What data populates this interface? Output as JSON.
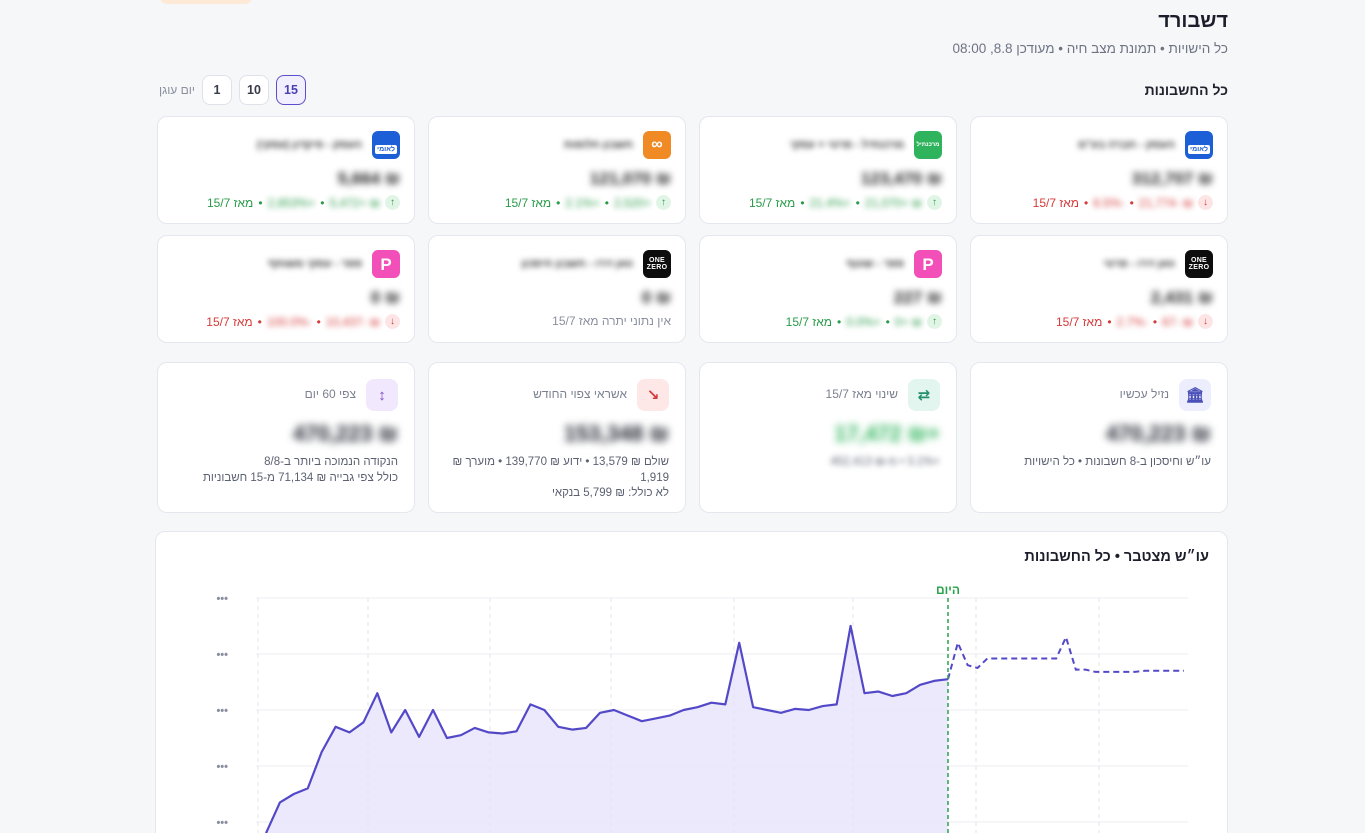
{
  "header": {
    "title": "דשבורד",
    "subtitle": "כל הישויות • תמונת מצב חיה • מעודכן 8.8, 08:00"
  },
  "accounts_section": {
    "title": "כל החשבונות",
    "window_label": "יום עוגן",
    "window_options": [
      "1",
      "10",
      "15"
    ],
    "active_window": "15"
  },
  "accounts": [
    {
      "logo": "leumi-logo",
      "logo_text": "לאומי",
      "name": "העסק - חברה בע\"מ",
      "balance": "₪ 312,707",
      "dir": "down",
      "amount": "₪ -21,774",
      "pct": "-6.5%",
      "since": "מאז 15/7"
    },
    {
      "logo": "green-bank-logo",
      "logo_text": "מרכנתיל",
      "name": "מרכנתיל - פרטי + עסקי",
      "balance": "₪ 123,470",
      "dir": "up",
      "amount": "₪ +21,070",
      "pct": "+21.4%",
      "since": "מאז 15/7"
    },
    {
      "logo": "orange-logo",
      "logo_text": "∞",
      "name": "חשבון חלופות",
      "balance": "₪ 121,070",
      "dir": "up",
      "amount": "+2,520",
      "pct": "+2.1%",
      "since": "מאז 15/7"
    },
    {
      "logo": "leumi-logo",
      "logo_text": "לאומי",
      "name": "העסק - פיקדון (עסקי)",
      "balance": "₪ 5,664",
      "dir": "up",
      "amount": "₪ +5,472",
      "pct": "+2,853%",
      "since": "מאז 15/7"
    },
    {
      "logo": "onezero-logo",
      "logo_text": "ONE ZERO",
      "name": "וואן זירו - פרטי",
      "balance": "₪ 2,431",
      "dir": "down",
      "amount": "₪ -67",
      "pct": "-2.7%",
      "since": "מאז 15/7"
    },
    {
      "logo": "pepper-logo",
      "logo_text": "P",
      "name": "פפר - שוטף",
      "balance": "₪ 227",
      "dir": "up",
      "amount": "₪ +0",
      "pct": "+0.0%",
      "since": "מאז 15/7"
    },
    {
      "logo": "onezero-logo",
      "logo_text": "ONE ZERO",
      "name": "וואן זירו - חשבון חיסכון",
      "balance": "₪ 0",
      "dir": "none",
      "amount": "",
      "pct": "",
      "since": "אין נתוני יתרה מאז 15/7"
    },
    {
      "logo": "pepper-logo",
      "logo_text": "P",
      "name": "פפר - עסקי משותף",
      "balance": "₪ 0",
      "dir": "down",
      "amount": "₪ -10,437",
      "pct": "-100.0%",
      "since": "מאז 15/7"
    }
  ],
  "stats": [
    {
      "icon": "bank-icon",
      "label": "נזיל עכשיו",
      "value": "₪ 470,223",
      "sub_lines": [
        "עו״ש וחיסכון ב-8 חשבונות • כל הישויות"
      ]
    },
    {
      "icon": "swap-icon",
      "label": "שינוי מאז 15/7",
      "value": "+₪ 17,472",
      "sub_lines": [
        "+3.1% • מ-₪ 452,413"
      ]
    },
    {
      "icon": "credit-down-icon",
      "label": "אשראי צפוי החודש",
      "value": "₪ 153,348",
      "sub_lines": [
        "שולם ₪ 13,579 • ידוע ₪ 139,770 • מוערך ₪ 1,919",
        "לא כולל: ₪ 5,799 בנקאי"
      ]
    },
    {
      "icon": "forecast-icon",
      "label": "צפי 60 יום",
      "value": "₪ 470,223",
      "sub_lines": [
        "הנקודה הנמוכה ביותר ב-8/8",
        "כולל צפי גבייה ₪ 71,134 מ-15 חשבוניות"
      ]
    }
  ],
  "chart": {
    "title": "עו״ש מצטבר • כל החשבונות",
    "today_label": "היום",
    "y_tick_label": "•••",
    "colors": {
      "line": "#5349c8",
      "fill": "#e7e4fb",
      "today": "#2aa24a"
    }
  },
  "chart_data": {
    "type": "line",
    "title": "עו״ש מצטבר • כל החשבונות",
    "xlabel": "",
    "ylabel": "",
    "y_tick_labels": [
      "•••",
      "•••",
      "•••",
      "•••",
      "•••"
    ],
    "series": [
      {
        "values": [
          80,
          135,
          150,
          160,
          225,
          270,
          260,
          278,
          330,
          260,
          300,
          252,
          300,
          250,
          255,
          268,
          260,
          258,
          262,
          310,
          300,
          270,
          265,
          268,
          295,
          300,
          290,
          280,
          285,
          290,
          300,
          305,
          313,
          310,
          420,
          305,
          300,
          295,
          302,
          300,
          307,
          310,
          450,
          330,
          333,
          325,
          330,
          345,
          352,
          355
        ]
      },
      {
        "values": [
          355,
          420,
          380,
          375,
          392,
          392,
          392,
          392,
          392,
          392,
          392,
          392,
          430,
          372,
          372,
          368,
          368,
          368,
          368,
          368,
          370,
          370,
          370,
          370,
          370
        ]
      }
    ],
    "grid": true,
    "today_marker": true
  }
}
